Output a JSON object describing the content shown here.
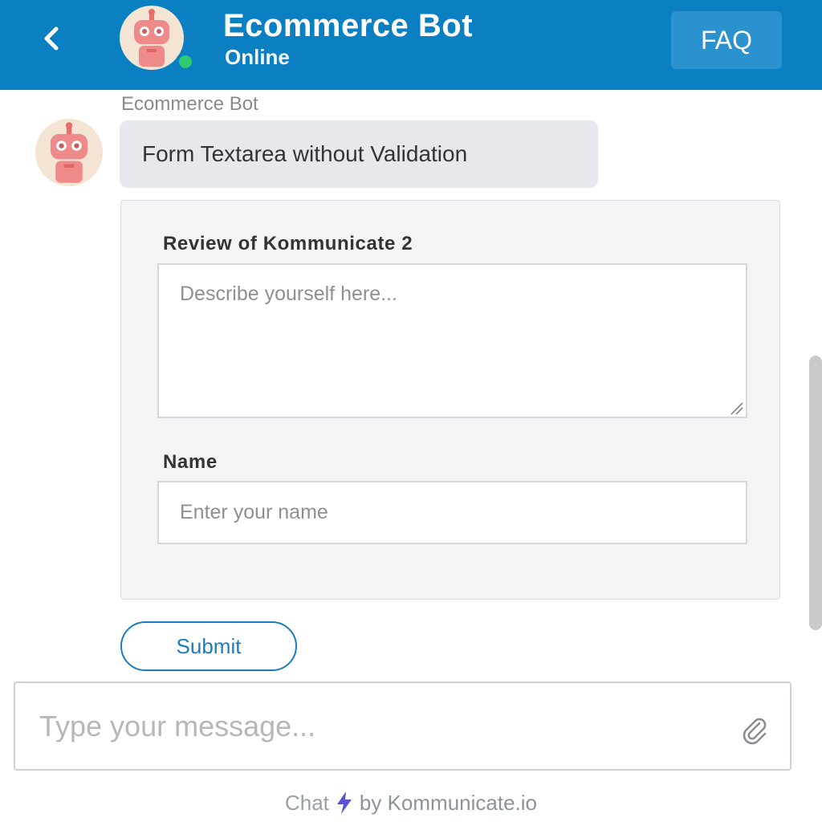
{
  "header": {
    "title": "Ecommerce Bot",
    "status": "Online",
    "faq_label": "FAQ",
    "back_icon": "chevron-left-icon",
    "status_color": "#2ecc71",
    "bar_color": "#0a7fc2"
  },
  "message": {
    "sender": "Ecommerce Bot",
    "text": "Form Textarea without Validation"
  },
  "form": {
    "review_label": "Review of Kommunicate 2",
    "review_placeholder": "Describe yourself here...",
    "name_label": "Name",
    "name_placeholder": "Enter your name",
    "submit_label": "Submit"
  },
  "composer": {
    "placeholder": "Type your message...",
    "attach_icon": "paperclip-icon"
  },
  "footer": {
    "prefix": "Chat",
    "bolt_icon": "lightning-icon",
    "suffix": "by Kommunicate.io",
    "bolt_color": "#5a4fd6"
  }
}
